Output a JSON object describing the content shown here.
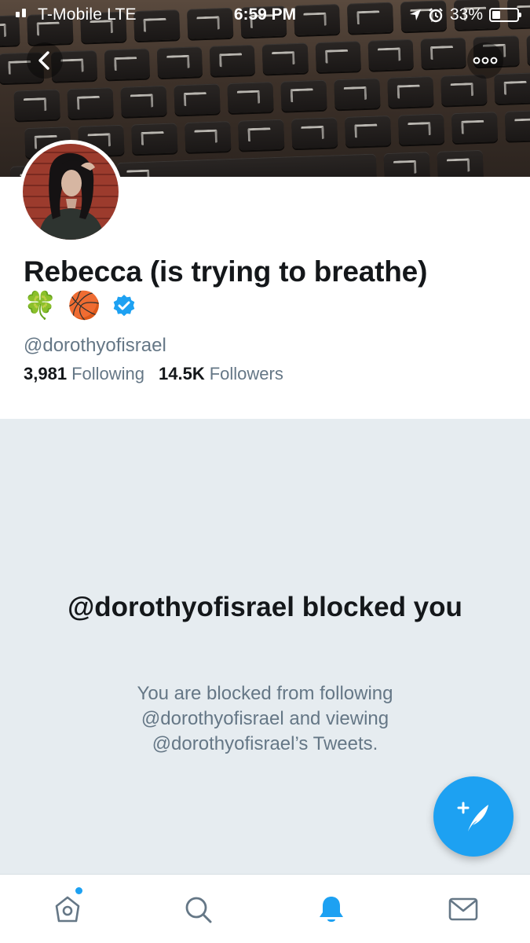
{
  "status_bar": {
    "carrier": "T-Mobile  LTE",
    "time": "6:59 PM",
    "battery": "33%"
  },
  "header": {
    "back_icon": "chevron-left-icon",
    "more_icon": "ellipsis-icon"
  },
  "profile": {
    "name": "Rebecca (is trying to breathe)",
    "emoji_1": "🍀",
    "emoji_2": "🏀",
    "verified_icon": "verified-badge-icon",
    "handle": "@dorothyofisrael",
    "following_count": "3,981",
    "following_label": "Following",
    "followers_count": "14.5K",
    "followers_label": "Followers"
  },
  "blocked": {
    "title": "@dorothyofisrael blocked you",
    "description": "You are blocked from following @dorothyofisrael and viewing @dorothyofisrael’s Tweets."
  },
  "compose": {
    "icon": "compose-tweet-icon"
  },
  "tabbar": {
    "items": [
      {
        "name": "home",
        "icon": "home-icon",
        "active": false,
        "has_badge": true
      },
      {
        "name": "search",
        "icon": "search-icon",
        "active": false
      },
      {
        "name": "notifications",
        "icon": "bell-icon",
        "active": true
      },
      {
        "name": "messages",
        "icon": "envelope-icon",
        "active": false
      }
    ]
  },
  "colors": {
    "accent": "#1da1f2",
    "secondary_text": "#657786",
    "panel_bg": "#e6ecf0"
  }
}
